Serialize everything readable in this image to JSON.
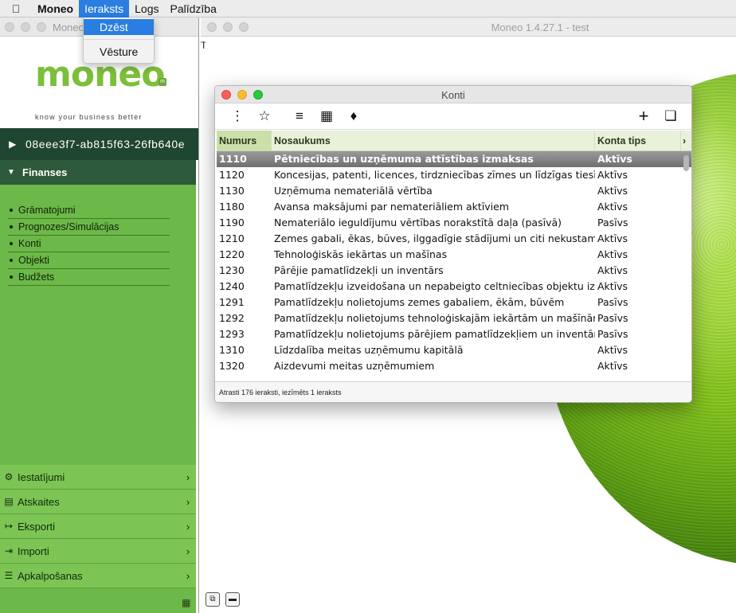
{
  "menubar": {
    "apple_icon": "apple-icon",
    "items": [
      "Moneo",
      "Ieraksts",
      "Logs",
      "Palīdzība"
    ],
    "active": "Ieraksts"
  },
  "dropdown": {
    "items": [
      "Dzēst",
      "Vēsture"
    ],
    "highlighted": "Dzēst"
  },
  "left_window": {
    "title": "Moneo",
    "title_suffix": "t",
    "logo_text": "moneo",
    "logo_mark": "m",
    "tagline": "know your business better",
    "company_id": "08eee3f7-ab815f63-26fb640e",
    "section": "Finanses",
    "finance_items": [
      "Grāmatojumi",
      "Prognozes/Simulācijas",
      "Konti",
      "Objekti",
      "Budžets"
    ],
    "bottom_nav": [
      {
        "label": "Iestatījumi",
        "icon": "gear-icon"
      },
      {
        "label": "Atskaites",
        "icon": "chart-icon"
      },
      {
        "label": "Eksporti",
        "icon": "export-icon"
      },
      {
        "label": "Importi",
        "icon": "import-icon"
      },
      {
        "label": "Apkalpošanas",
        "icon": "server-icon"
      }
    ]
  },
  "main_window": {
    "title": "Moneo 1.4.27.1 - test",
    "partial_text": "T"
  },
  "konti": {
    "title": "Konti",
    "toolbar": [
      "more-vertical-icon",
      "star-icon",
      "filter-icon",
      "excel-icon",
      "tag-icon",
      "add-icon",
      "copy-icon"
    ],
    "columns": [
      "Numurs",
      "Nosaukums",
      "Konta tips"
    ],
    "rows": [
      {
        "num": "1110",
        "name": "Pētniecības un uzņēmuma attīstības izmaksas",
        "type": "Aktīvs"
      },
      {
        "num": "1120",
        "name": "Koncesijas, patenti, licences, tirdzniecības zīmes un līdzīgas tiesības",
        "type": "Aktīvs"
      },
      {
        "num": "1130",
        "name": "Uzņēmuma nemateriālā vērtība",
        "type": "Aktīvs"
      },
      {
        "num": "1180",
        "name": "Avansa maksājumi par nemateriāliem aktīviem",
        "type": "Aktīvs"
      },
      {
        "num": "1190",
        "name": "Nemateriālo ieguldījumu vērtības norakstītā daļa (pasīvā)",
        "type": "Pasīvs"
      },
      {
        "num": "1210",
        "name": "Zemes gabali, ēkas, būves, ilggadīgie stādījumi un citi nekustamā īpašuma objekti",
        "type": "Aktīvs"
      },
      {
        "num": "1220",
        "name": "Tehnoloģiskās iekārtas un mašīnas",
        "type": "Aktīvs"
      },
      {
        "num": "1230",
        "name": "Pārējie pamatlīdzekļi un inventārs",
        "type": "Aktīvs"
      },
      {
        "num": "1240",
        "name": "Pamatlīdzekļu izveidošana un nepabeigto celtniecības objektu izmaksas",
        "type": "Aktīvs"
      },
      {
        "num": "1291",
        "name": "Pamatlīdzekļu nolietojums zemes gabaliem, ēkām, būvēm",
        "type": "Pasīvs"
      },
      {
        "num": "1292",
        "name": "Pamatlīdzekļu nolietojums tehnoloģiskajām iekārtām un mašīnām",
        "type": "Pasīvs"
      },
      {
        "num": "1293",
        "name": "Pamatlīdzekļu nolietojums pārējiem pamatlīdzekļiem un inventāram",
        "type": "Pasīvs"
      },
      {
        "num": "1310",
        "name": "Līdzdalība meitas uzņēmumu kapitālā",
        "type": "Aktīvs"
      },
      {
        "num": "1320",
        "name": "Aizdevumi meitas uzņēmumiem",
        "type": "Aktīvs"
      }
    ],
    "selected_row": "1110",
    "status": "Atrasti 176 ieraksti, iezīmēts 1 ieraksts"
  }
}
